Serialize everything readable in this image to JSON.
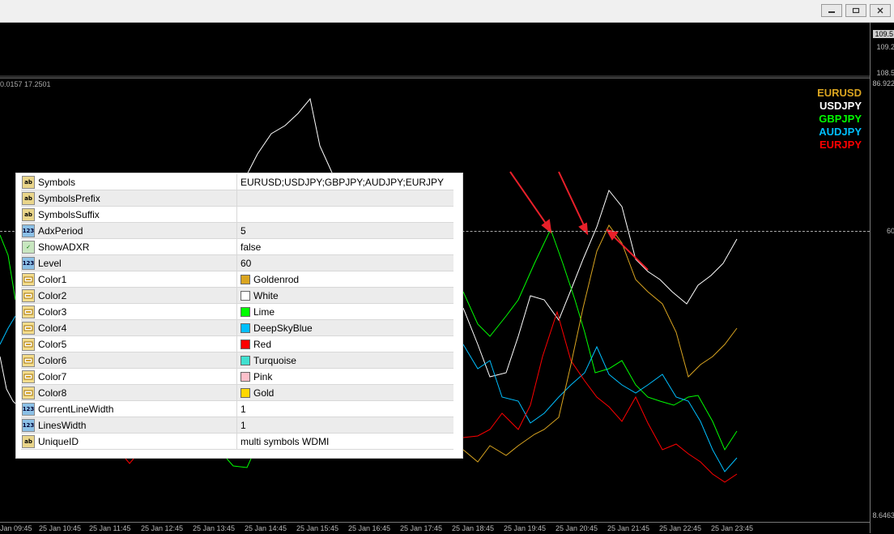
{
  "price_scale": {
    "upper": [
      "109.5",
      "109.2",
      "108.5"
    ],
    "indicator_top": "86.922",
    "level": "60",
    "indicator_bottom": "8.6463"
  },
  "indicator_info": "0.0157 17.2501",
  "legend": [
    {
      "label": "EURUSD",
      "color": "#DAA520"
    },
    {
      "label": "USDJPY",
      "color": "#FFFFFF"
    },
    {
      "label": "GBPJPY",
      "color": "#00FF00"
    },
    {
      "label": "AUDJPY",
      "color": "#00BFFF"
    },
    {
      "label": "EURJPY",
      "color": "#FF0000"
    }
  ],
  "x_axis": [
    "Jan 09:45",
    "25 Jan 10:45",
    "25 Jan 11:45",
    "25 Jan 12:45",
    "25 Jan 13:45",
    "25 Jan 14:45",
    "25 Jan 15:45",
    "25 Jan 16:45",
    "25 Jan 17:45",
    "25 Jan 18:45",
    "25 Jan 19:45",
    "25 Jan 20:45",
    "25 Jan 21:45",
    "25 Jan 22:45",
    "25 Jan 23:45"
  ],
  "properties": [
    {
      "name": "Symbols",
      "icon": "ab",
      "value": "EURUSD;USDJPY;GBPJPY;AUDJPY;EURJPY"
    },
    {
      "name": "SymbolsPrefix",
      "icon": "ab",
      "value": ""
    },
    {
      "name": "SymbolsSuffix",
      "icon": "ab",
      "value": ""
    },
    {
      "name": "AdxPeriod",
      "icon": "num",
      "value": "5"
    },
    {
      "name": "ShowADXR",
      "icon": "bool",
      "value": "false"
    },
    {
      "name": "Level",
      "icon": "num",
      "value": "60"
    },
    {
      "name": "Color1",
      "icon": "color",
      "value": "Goldenrod",
      "swatch": "#DAA520"
    },
    {
      "name": "Color2",
      "icon": "color",
      "value": "White",
      "swatch": "#FFFFFF"
    },
    {
      "name": "Color3",
      "icon": "color",
      "value": "Lime",
      "swatch": "#00FF00"
    },
    {
      "name": "Color4",
      "icon": "color",
      "value": "DeepSkyBlue",
      "swatch": "#00BFFF"
    },
    {
      "name": "Color5",
      "icon": "color",
      "value": "Red",
      "swatch": "#FF0000"
    },
    {
      "name": "Color6",
      "icon": "color",
      "value": "Turquoise",
      "swatch": "#40E0D0"
    },
    {
      "name": "Color7",
      "icon": "color",
      "value": "Pink",
      "swatch": "#FFC0CB"
    },
    {
      "name": "Color8",
      "icon": "color",
      "value": "Gold",
      "swatch": "#FFD700"
    },
    {
      "name": "CurrentLineWidth",
      "icon": "num",
      "value": "1"
    },
    {
      "name": "LinesWidth",
      "icon": "num",
      "value": "1"
    },
    {
      "name": "UniqueID",
      "icon": "ab",
      "value": "multi symbols WDMI"
    }
  ]
}
